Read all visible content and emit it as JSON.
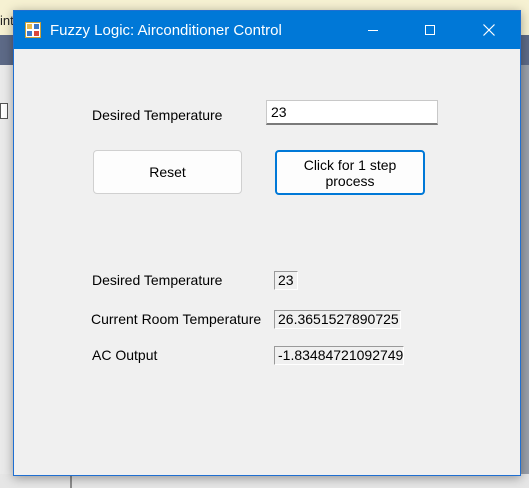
{
  "background": {
    "partial_text": "int"
  },
  "window": {
    "title": "Fuzzy Logic: Airconditioner Control",
    "controls": [
      "minimize",
      "maximize",
      "close"
    ]
  },
  "form": {
    "desired_label": "Desired Temperature",
    "desired_value": "23",
    "reset_button": "Reset",
    "step_button": "Click for 1 step process"
  },
  "output": {
    "desired_label": "Desired Temperature",
    "desired_value": "23",
    "current_label": "Current Room Temperature",
    "current_value": "26.3651527890725",
    "ac_label": "AC Output",
    "ac_value": "-1.83484721092749"
  },
  "colors": {
    "titlebar": "#0078d7",
    "window_bg": "#f0f0f0",
    "focus": "#0078d7"
  }
}
